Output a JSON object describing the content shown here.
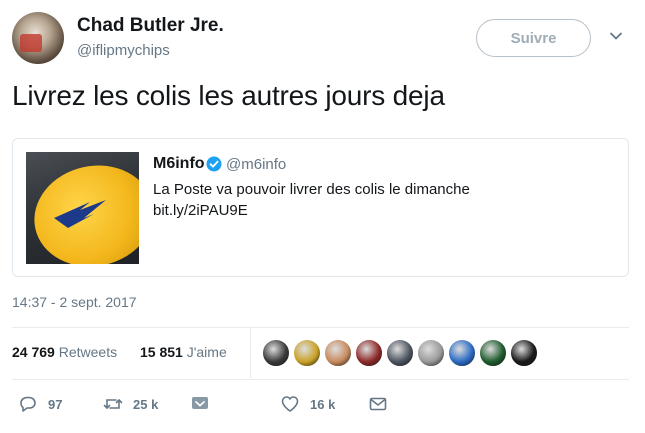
{
  "author": {
    "name": "Chad Butler Jre.",
    "handle": "@iflipmychips"
  },
  "follow_label": "Suivre",
  "tweet_text": "Livrez les colis les autres jours deja",
  "quoted": {
    "name": "M6info",
    "handle": "@m6info",
    "text": "La Poste va pouvoir livrer des colis le dimanche",
    "link": "bit.ly/2iPAU9E"
  },
  "timestamp": "14:37 - 2 sept. 2017",
  "stats": {
    "retweets_count": "24 769",
    "retweets_label": "Retweets",
    "likes_count": "15 851",
    "likes_label": "J'aime"
  },
  "liker_avatars": [
    {
      "color": "#3a3a3a"
    },
    {
      "color": "#c9a227"
    },
    {
      "color": "#c88a5e"
    },
    {
      "color": "#8e2a2a"
    },
    {
      "color": "#4c5560"
    },
    {
      "color": "#9a9a9a"
    },
    {
      "color": "#2b6cc4"
    },
    {
      "color": "#1f5c2e"
    },
    {
      "color": "#1a1a1a"
    }
  ],
  "actions": {
    "reply_count": "97",
    "retweet_count": "25 k",
    "like_count": "16 k"
  },
  "colors": {
    "text": "#14171a",
    "muted": "#657786",
    "verified": "#1da1f2",
    "border": "#e1e8ed"
  }
}
